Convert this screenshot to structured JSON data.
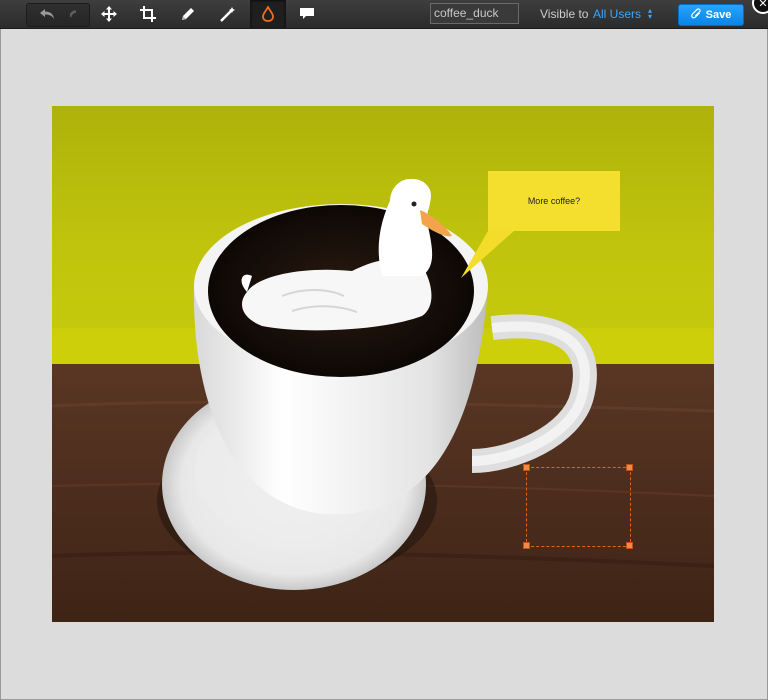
{
  "toolbar": {
    "undo_icon": "undo-icon",
    "redo_icon": "redo-icon",
    "tools": [
      {
        "name": "move-tool",
        "icon": "move-icon"
      },
      {
        "name": "crop-tool",
        "icon": "crop-icon"
      },
      {
        "name": "pencil-tool",
        "icon": "pencil-icon"
      },
      {
        "name": "magic-wand-tool",
        "icon": "magic-wand-icon"
      },
      {
        "name": "blur-tool",
        "icon": "drop-icon",
        "active": true
      },
      {
        "name": "callout-tool",
        "icon": "speech-bubble-icon"
      }
    ],
    "image_name": "coffee_duck",
    "visible_label": "Visible to",
    "visible_value": "All Users",
    "save_label": "Save"
  },
  "canvas": {
    "callout_text": "More coffee?"
  },
  "colors": {
    "accent": "#1a90f0",
    "selection": "#e0641b",
    "toolbar": "#333333",
    "wall": "#b8bf0a",
    "table": "#4e2e1e"
  }
}
